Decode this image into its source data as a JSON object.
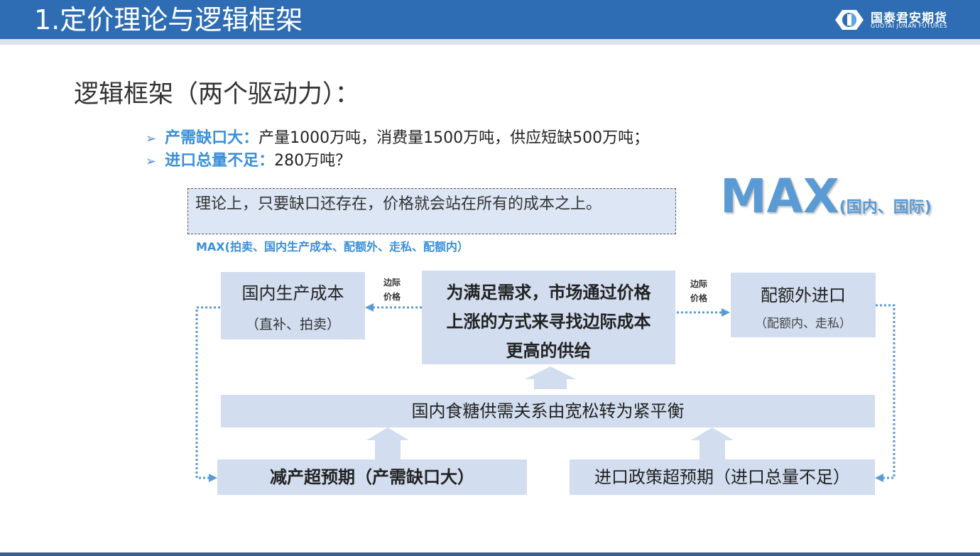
{
  "header": {
    "title": "1.定价理论与逻辑框架",
    "brand_cn": "国泰君安期货",
    "brand_en": "GUOTAI JUNAN FUTURES"
  },
  "section_title": "逻辑框架（两个驱动力）：",
  "bullets": [
    {
      "key": "产需缺口大：",
      "text": "产量1000万吨，消费量1500万吨，供应短缺500万吨；"
    },
    {
      "key": "进口总量不足：",
      "text": "280万吨？"
    }
  ],
  "theory_note": "理论上，只要缺口还存在，价格就会站在所有的成本之上。",
  "max_note": "MAX(拍卖、国内生产成本、配额外、走私、配额内）",
  "max_big": {
    "word": "MAX",
    "scope": "(国内、国际)"
  },
  "diagram": {
    "domestic_cost": {
      "main": "国内生产成本",
      "sub": "（直补、拍卖）"
    },
    "market_search": {
      "lines": [
        "为满足需求，市场通过价格",
        "上涨的方式来寻找边际成本",
        "更高的供给"
      ]
    },
    "quota_import": {
      "main": "配额外进口",
      "sub": "（配额内、走私）"
    },
    "balance": "国内食糖供需关系由宽松转为紧平衡",
    "reduction": "减产超预期（产需缺口大）",
    "import_policy": "进口政策超预期（进口总量不足）",
    "edge_left": [
      "边际",
      "价格"
    ],
    "edge_right": [
      "边际",
      "价格"
    ]
  },
  "colors": {
    "header_bg": "#2e6db4",
    "accent_blue": "#3a8fd9",
    "box_fill": "#d2ddef",
    "connector": "#5b9bd5"
  }
}
